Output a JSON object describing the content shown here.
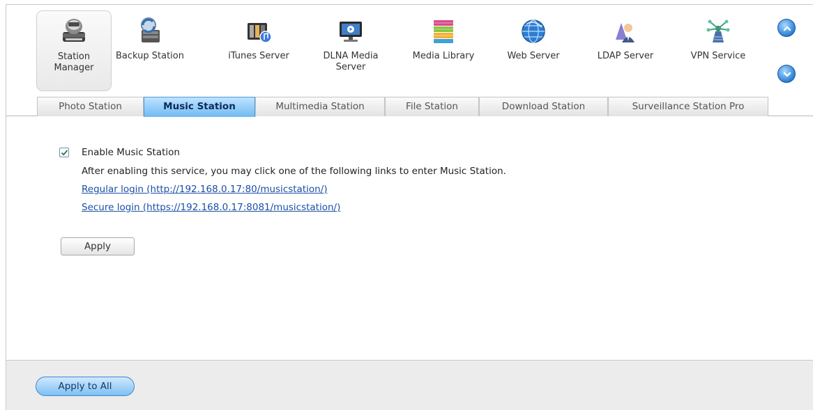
{
  "apps": [
    {
      "label": "Station Manager",
      "icon": "station-manager-icon",
      "active": true
    },
    {
      "label": "Backup Station",
      "icon": "backup-station-icon",
      "active": false
    },
    {
      "label": "iTunes Server",
      "icon": "itunes-server-icon",
      "active": false
    },
    {
      "label": "DLNA Media Server",
      "icon": "dlna-media-server-icon",
      "active": false
    },
    {
      "label": "Media Library",
      "icon": "media-library-icon",
      "active": false
    },
    {
      "label": "Web Server",
      "icon": "web-server-icon",
      "active": false
    },
    {
      "label": "LDAP Server",
      "icon": "ldap-server-icon",
      "active": false
    },
    {
      "label": "VPN Service",
      "icon": "vpn-service-icon",
      "active": false
    }
  ],
  "scroll": {
    "up_icon": "chevron-up-icon",
    "down_icon": "chevron-down-icon"
  },
  "tabs": [
    {
      "label": "Photo Station",
      "active": false
    },
    {
      "label": "Music Station",
      "active": true
    },
    {
      "label": "Multimedia Station",
      "active": false
    },
    {
      "label": "File Station",
      "active": false
    },
    {
      "label": "Download Station",
      "active": false
    },
    {
      "label": "Surveillance Station Pro",
      "active": false
    }
  ],
  "content": {
    "enable_label": "Enable Music Station",
    "enable_checked": true,
    "description": "After enabling this service, you may click one of the following links to enter Music Station.",
    "regular_login": "Regular login (http://192.168.0.17:80/musicstation/)",
    "secure_login": "Secure login (https://192.168.0.17:8081/musicstation/)",
    "apply_label": "Apply"
  },
  "footer": {
    "apply_all_label": "Apply to All"
  },
  "colors": {
    "accent": "#6fbaf3",
    "link": "#1a4fa6",
    "footer_bg": "#ececec"
  }
}
